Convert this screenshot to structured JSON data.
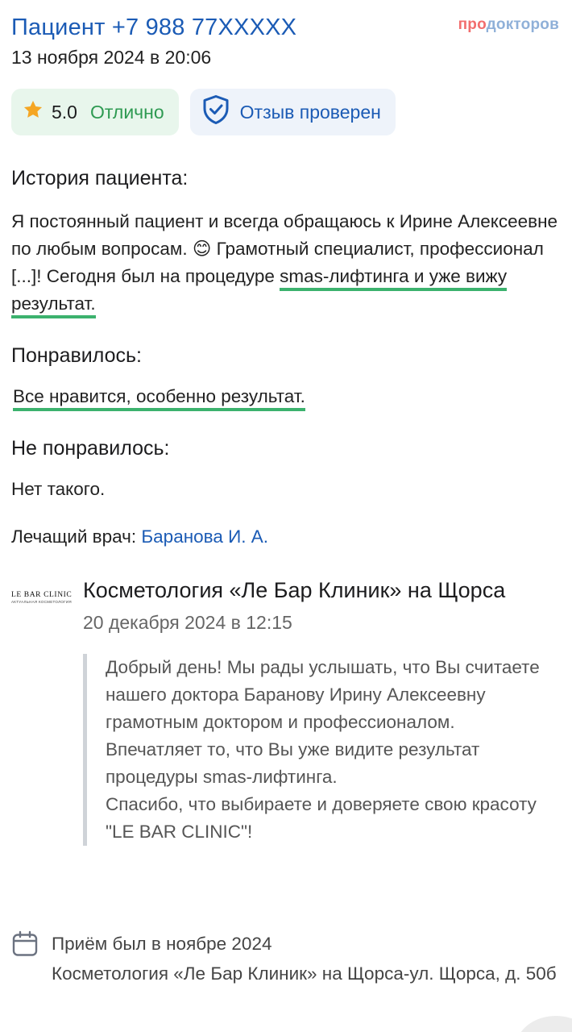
{
  "header": {
    "patient_title": "Пациент +7 988 77XXXXX",
    "date": "13 ноября 2024 в 20:06",
    "brand_part1": "про",
    "brand_part2": "докторов"
  },
  "badges": {
    "rating_icon": "star-icon",
    "rating_score": "5.0",
    "rating_word": "Отлично",
    "verified_icon": "shield-check-icon",
    "verified_label": "Отзыв проверен"
  },
  "history": {
    "heading": "История пациента:",
    "text_before": "Я постоянный пациент и всегда обращаюсь к Ирине Алексеевне по любым вопросам. 😊 Грамотный специалист, профессионал [...]! Сегодня был на процедуре ",
    "text_highlight": "smas-лифтинга и уже вижу результат."
  },
  "liked": {
    "heading": "Понравилось:",
    "text": "Все нравится, особенно результат."
  },
  "disliked": {
    "heading": "Не понравилось:",
    "text": "Нет такого."
  },
  "doctor": {
    "label": "Лечащий врач:",
    "name": "Баранова И. А."
  },
  "reply": {
    "logo_text": "LE BAR CLINIC",
    "logo_subtext": "АКТУАЛЬНАЯ КОСМЕТОЛОГИЯ",
    "clinic_name": "Косметология «Ле Бар Клиник» на Щорса",
    "date": "20 декабря 2024 в 12:15",
    "paragraph1": "Добрый день! Мы рады услышать, что Вы считаете нашего доктора Баранову Ирину Алексеевну грамотным доктором и профессионалом. Впечатляет то, что Вы уже видите результат процедуры smas-лифтинга.",
    "paragraph2": "Спасибо, что выбираете и доверяете свою красоту \"LE BAR CLINIC\"!"
  },
  "visit": {
    "icon": "calendar-icon",
    "line1": "Приём был в ноябре 2024",
    "line2": "Косметология «Ле Бар Клиник» на Щорса-ул. Щорса, д. 50б"
  },
  "colors": {
    "link_blue": "#1b5bb5",
    "rating_green": "#2e9a52",
    "highlight_green": "#3cb26e",
    "star": "#f5a623"
  }
}
